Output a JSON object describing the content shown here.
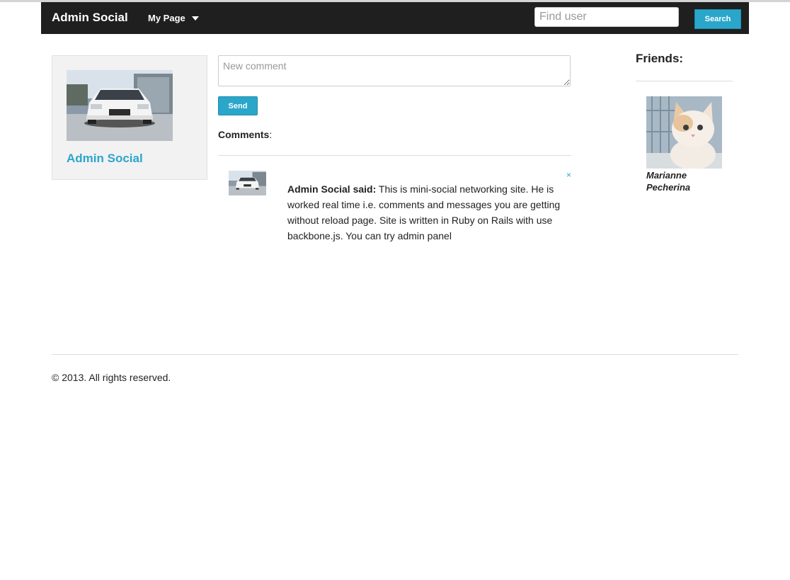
{
  "navbar": {
    "brand": "Admin Social",
    "menu_label": "My Page",
    "search_placeholder": "Find user",
    "search_button": "Search"
  },
  "profile": {
    "name": "Admin Social",
    "photo_icon": "car-photo"
  },
  "composer": {
    "placeholder": "New comment",
    "send_label": "Send"
  },
  "comments": {
    "heading": "Comments",
    "heading_suffix": ":",
    "items": [
      {
        "author": "Admin Social said:",
        "text": "This is mini-social networking site. He is worked real time i.e. comments and messages you are getting without reload page. Site is written in Ruby on Rails with use backbone.js. You can try admin panel",
        "close_label": "×"
      }
    ]
  },
  "friends": {
    "title": "Friends:",
    "items": [
      {
        "name": "Marianne Pecherina",
        "photo_icon": "kitten-photo"
      }
    ]
  },
  "footer": {
    "copyright": "© 2013. All rights reserved."
  },
  "colors": {
    "navbar_bg": "#1f1f1f",
    "accent": "#2ba6cb",
    "card_bg": "#f2f2f2"
  }
}
